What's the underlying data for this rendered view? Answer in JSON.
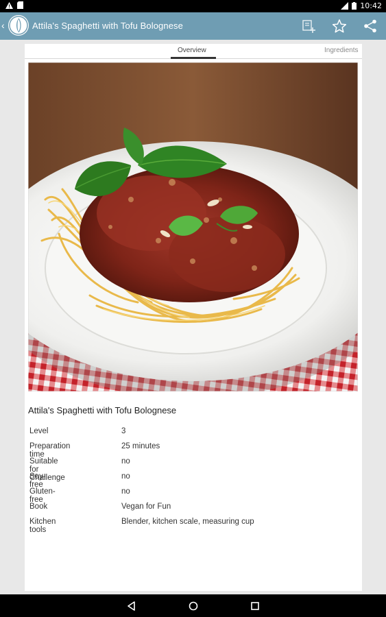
{
  "status": {
    "time": "10:42"
  },
  "app_bar": {
    "title": "Attila's Spaghetti with Tofu Bolognese",
    "actions": [
      "add-to-list-icon",
      "star-icon",
      "share-icon"
    ]
  },
  "tabs": [
    {
      "label": "Overview",
      "selected": true
    },
    {
      "label": "Ingredients",
      "selected": false
    }
  ],
  "recipe": {
    "title": "Attila's Spaghetti with Tofu Bolognese",
    "details": [
      {
        "label": "Level",
        "value": "3"
      },
      {
        "label": "Preparation time",
        "value": "25 minutes"
      },
      {
        "label": "Suitable for Challenge",
        "value": "no"
      },
      {
        "label": "Soy-free",
        "value": "no"
      },
      {
        "label": "Gluten-free",
        "value": "no"
      },
      {
        "label": "Book",
        "value": "Vegan for Fun"
      },
      {
        "label": "Kitchen tools",
        "value": "Blender, kitchen scale, measuring cup"
      }
    ]
  },
  "colors": {
    "app_bar": "#6f9db3",
    "background": "#e8e8e8"
  }
}
